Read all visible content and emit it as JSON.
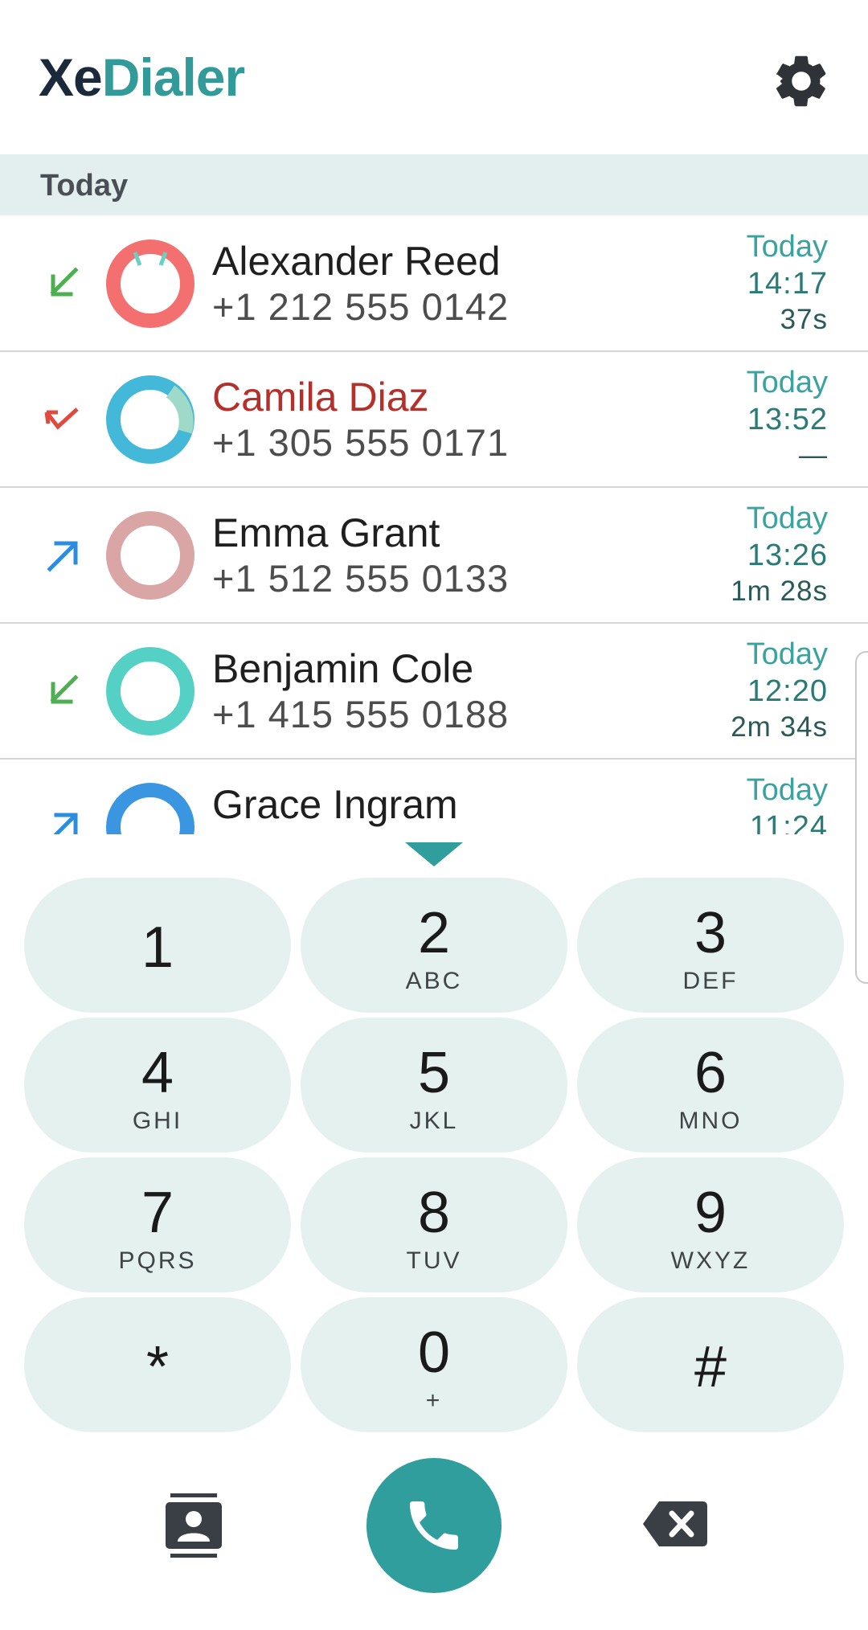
{
  "app": {
    "title_part1": "Xe",
    "title_part2": "Dialer"
  },
  "colors": {
    "accent": "#339a9a",
    "missed": "#b3302b",
    "incoming": "#4caf50",
    "outgoing": "#2b8de0",
    "key_bg": "#e5f1ef"
  },
  "icons": {
    "settings": "gear-icon",
    "contacts": "contacts-icon",
    "call": "phone-icon",
    "backspace": "backspace-icon",
    "collapse": "chevron-down-icon"
  },
  "section": {
    "label": "Today"
  },
  "calls": [
    {
      "name": "Alexander Reed",
      "number": "+1 212 555 0142",
      "date": "Today",
      "time": "14:17",
      "duration": "37s",
      "type": "incoming",
      "avatar_color": "#f47070"
    },
    {
      "name": "Camila Diaz",
      "number": "+1 305 555 0171",
      "date": "Today",
      "time": "13:52",
      "duration": "—",
      "type": "missed",
      "avatar_color": "#44b8d8"
    },
    {
      "name": "Emma Grant",
      "number": "+1 512 555 0133",
      "date": "Today",
      "time": "13:26",
      "duration": "1m 28s",
      "type": "outgoing",
      "avatar_color": "#d9a5a5"
    },
    {
      "name": "Benjamin Cole",
      "number": "+1 415 555 0188",
      "date": "Today",
      "time": "12:20",
      "duration": "2m 34s",
      "type": "incoming",
      "avatar_color": "#55d0c4"
    },
    {
      "name": "Grace Ingram",
      "number": "",
      "date": "Today",
      "time": "11:24",
      "duration": "",
      "type": "outgoing",
      "avatar_color": "#3a96e0"
    }
  ],
  "keypad": [
    {
      "digit": "1",
      "letters": ""
    },
    {
      "digit": "2",
      "letters": "ABC"
    },
    {
      "digit": "3",
      "letters": "DEF"
    },
    {
      "digit": "4",
      "letters": "GHI"
    },
    {
      "digit": "5",
      "letters": "JKL"
    },
    {
      "digit": "6",
      "letters": "MNO"
    },
    {
      "digit": "7",
      "letters": "PQRS"
    },
    {
      "digit": "8",
      "letters": "TUV"
    },
    {
      "digit": "9",
      "letters": "WXYZ"
    },
    {
      "digit": "*",
      "letters": ""
    },
    {
      "digit": "0",
      "letters": "+"
    },
    {
      "digit": "#",
      "letters": ""
    }
  ]
}
